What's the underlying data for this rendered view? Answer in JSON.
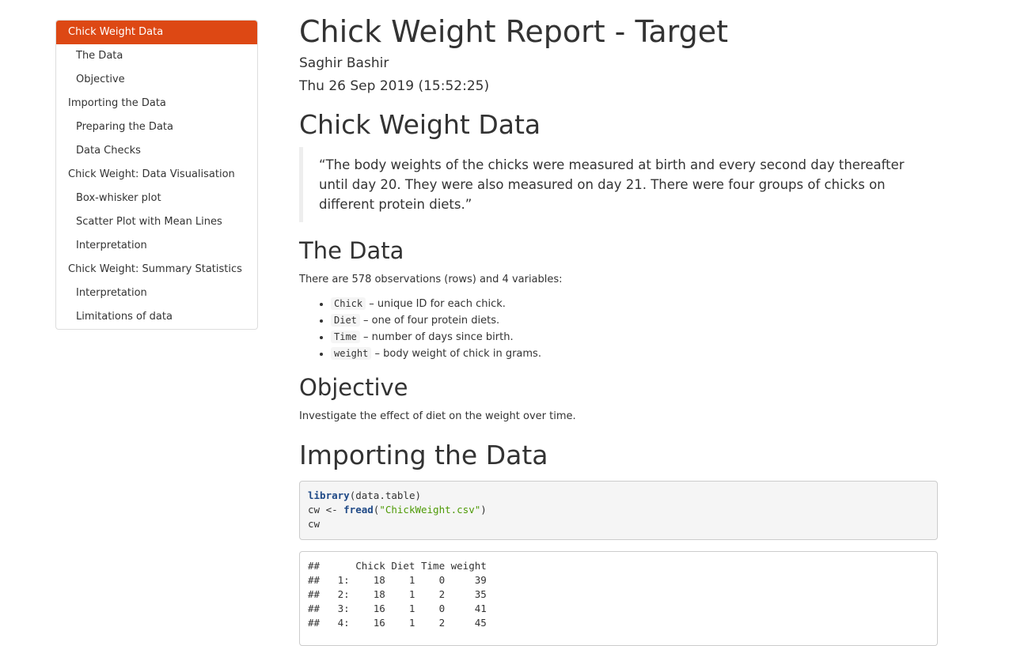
{
  "toc": {
    "items": [
      {
        "label": "Chick Weight Data",
        "level": 1,
        "active": true
      },
      {
        "label": "The Data",
        "level": 2
      },
      {
        "label": "Objective",
        "level": 2
      },
      {
        "label": "Importing the Data",
        "level": 1
      },
      {
        "label": "Preparing the Data",
        "level": 2
      },
      {
        "label": "Data Checks",
        "level": 2
      },
      {
        "label": "Chick Weight: Data Visualisation",
        "level": 1
      },
      {
        "label": "Box-whisker plot",
        "level": 2
      },
      {
        "label": "Scatter Plot with Mean Lines",
        "level": 2
      },
      {
        "label": "Interpretation",
        "level": 2
      },
      {
        "label": "Chick Weight: Summary Statistics",
        "level": 1
      },
      {
        "label": "Interpretation",
        "level": 2
      },
      {
        "label": "Limitations of data",
        "level": 2
      }
    ],
    "accent_color": "#dd4814"
  },
  "header": {
    "title": "Chick Weight Report - Target",
    "author": "Saghir Bashir",
    "date": "Thu 26 Sep 2019 (15:52:25)"
  },
  "sections": {
    "chick_weight_data": {
      "heading": "Chick Weight Data",
      "quote": "“The body weights of the chicks were measured at birth and every second day thereafter until day 20. They were also measured on day 21. There were four groups of chicks on different protein diets.”"
    },
    "the_data": {
      "heading": "The Data",
      "intro": "There are 578 observations (rows) and 4 variables:",
      "variables": [
        {
          "code": "Chick",
          "desc": " – unique ID for each chick."
        },
        {
          "code": "Diet",
          "desc": " – one of four protein diets."
        },
        {
          "code": "Time",
          "desc": " – number of days since birth."
        },
        {
          "code": "weight",
          "desc": " – body weight of chick in grams."
        }
      ]
    },
    "objective": {
      "heading": "Objective",
      "text": "Investigate the effect of diet on the weight over time."
    },
    "importing": {
      "heading": "Importing the Data",
      "code": {
        "line1_fn": "library",
        "line1_rest": "(data.table)",
        "line2_pre": "cw <- ",
        "line2_fn": "fread",
        "line2_open": "(",
        "line2_str": "\"ChickWeight.csv\"",
        "line2_close": ")",
        "line3": "cw"
      },
      "output": [
        "##      Chick Diet Time weight",
        "##   1:    18    1    0     39",
        "##   2:    18    1    2     35",
        "##   3:    16    1    0     41",
        "##   4:    16    1    2     45"
      ]
    }
  }
}
